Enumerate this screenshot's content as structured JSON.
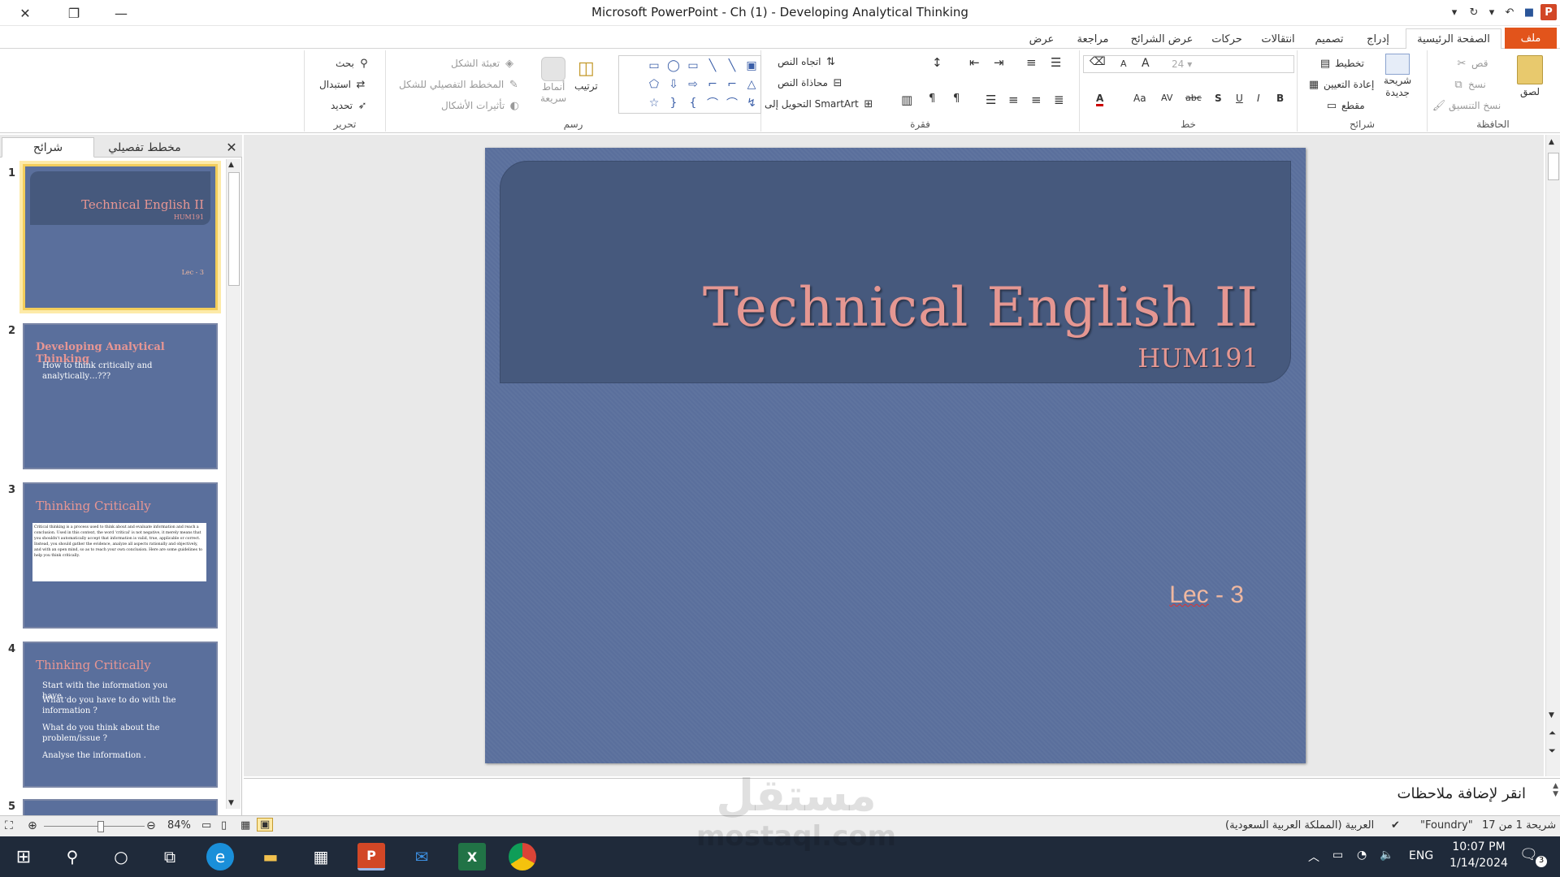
{
  "window": {
    "title": "Microsoft PowerPoint - Ch (1) - Developing Analytical Thinking",
    "app_badge": "P"
  },
  "tabs": {
    "file": "ملف",
    "home": "الصفحة الرئيسية",
    "insert": "إدراج",
    "design": "تصميم",
    "transitions": "انتقالات",
    "animations": "حركات",
    "slideshow": "عرض الشرائح",
    "review": "مراجعة",
    "view": "عرض"
  },
  "ribbon": {
    "clipboard": {
      "label": "الحافظة",
      "paste": "لصق",
      "cut": "قص",
      "copy": "نسخ",
      "format_painter": "نسخ التنسيق"
    },
    "slides": {
      "label": "شرائح",
      "new_slide_1": "شريحة",
      "new_slide_2": "جديدة",
      "layout": "تخطيط",
      "reset": "إعادة التعيين",
      "section": "مقطع"
    },
    "font": {
      "label": "خط",
      "size": "24",
      "bold": "B",
      "italic": "I",
      "underline": "U",
      "strike": "S",
      "shadow": "abc",
      "spacing": "AV",
      "case": "Aa",
      "color": "A",
      "grow": "A",
      "shrink": "A"
    },
    "paragraph": {
      "label": "فقرة",
      "text_direction": "اتجاه النص",
      "align_text": "محاذاة النص",
      "smartart": "التحويل إلى SmartArt"
    },
    "drawing": {
      "label": "رسم",
      "arrange": "ترتيب",
      "quick_styles_1": "أنماط",
      "quick_styles_2": "سريعة",
      "shape_fill": "تعبئة الشكل",
      "shape_outline": "المخطط التفصيلي للشكل",
      "shape_effects": "تأثيرات الأشكال"
    },
    "editing": {
      "label": "تحرير",
      "find": "بحث",
      "replace": "استبدال",
      "select": "تحديد"
    }
  },
  "panel": {
    "tab_slides": "شرائح",
    "tab_outline": "مخطط تفصيلي",
    "thumbnails": [
      {
        "num": "1",
        "title": "Technical English II",
        "sub": "HUM191",
        "lec": "Lec - 3"
      },
      {
        "num": "2",
        "title": "Developing  Analytical Thinking",
        "body": [
          "How to think critically and",
          "analytically…???"
        ]
      },
      {
        "num": "3",
        "title": "Thinking Critically",
        "body_text": "Critical thinking is a process used to think about and evaluate information and reach a conclusion. Used in this context, the word 'critical' is not negative, it merely means that you shouldn't automatically accept that information is valid, true, applicable or correct. Instead, you should gather the evidence, analyze all aspects rationally and objectively, and with an open mind, so as to reach your own conclusion. Here are some guidelines to help you think critically."
      },
      {
        "num": "4",
        "title": "Thinking Critically",
        "body": [
          "Start with the information you have .",
          "What do you have to do with the information ?",
          "What do you think about the problem/issue ?",
          "Analyse the information ."
        ]
      },
      {
        "num": "5"
      }
    ]
  },
  "slide": {
    "title": "Technical English II",
    "subtitle": "HUM191",
    "lec_word": "Lec",
    "lec_rest": " - 3"
  },
  "notes": {
    "placeholder": "انقر لإضافة ملاحظات"
  },
  "status": {
    "slide_of": "شريحة 1 من 17",
    "theme": "\"Foundry\"",
    "language": "العربية (المملكة العربية السعودية)",
    "zoom": "84%"
  },
  "taskbar": {
    "time": "10:07 PM",
    "date": "1/14/2024",
    "lang": "ENG",
    "notif_count": "3"
  },
  "watermark": {
    "arabic": "مستقل",
    "latin": "mostaql.com"
  }
}
